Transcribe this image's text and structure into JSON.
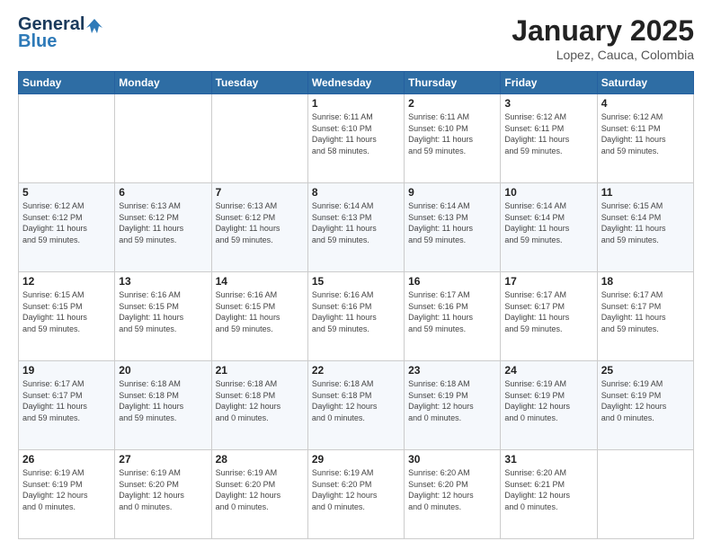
{
  "header": {
    "logo_general": "General",
    "logo_blue": "Blue",
    "title": "January 2025",
    "subtitle": "Lopez, Cauca, Colombia"
  },
  "weekdays": [
    "Sunday",
    "Monday",
    "Tuesday",
    "Wednesday",
    "Thursday",
    "Friday",
    "Saturday"
  ],
  "weeks": [
    [
      {
        "day": "",
        "info": ""
      },
      {
        "day": "",
        "info": ""
      },
      {
        "day": "",
        "info": ""
      },
      {
        "day": "1",
        "info": "Sunrise: 6:11 AM\nSunset: 6:10 PM\nDaylight: 11 hours\nand 58 minutes."
      },
      {
        "day": "2",
        "info": "Sunrise: 6:11 AM\nSunset: 6:10 PM\nDaylight: 11 hours\nand 59 minutes."
      },
      {
        "day": "3",
        "info": "Sunrise: 6:12 AM\nSunset: 6:11 PM\nDaylight: 11 hours\nand 59 minutes."
      },
      {
        "day": "4",
        "info": "Sunrise: 6:12 AM\nSunset: 6:11 PM\nDaylight: 11 hours\nand 59 minutes."
      }
    ],
    [
      {
        "day": "5",
        "info": "Sunrise: 6:12 AM\nSunset: 6:12 PM\nDaylight: 11 hours\nand 59 minutes."
      },
      {
        "day": "6",
        "info": "Sunrise: 6:13 AM\nSunset: 6:12 PM\nDaylight: 11 hours\nand 59 minutes."
      },
      {
        "day": "7",
        "info": "Sunrise: 6:13 AM\nSunset: 6:12 PM\nDaylight: 11 hours\nand 59 minutes."
      },
      {
        "day": "8",
        "info": "Sunrise: 6:14 AM\nSunset: 6:13 PM\nDaylight: 11 hours\nand 59 minutes."
      },
      {
        "day": "9",
        "info": "Sunrise: 6:14 AM\nSunset: 6:13 PM\nDaylight: 11 hours\nand 59 minutes."
      },
      {
        "day": "10",
        "info": "Sunrise: 6:14 AM\nSunset: 6:14 PM\nDaylight: 11 hours\nand 59 minutes."
      },
      {
        "day": "11",
        "info": "Sunrise: 6:15 AM\nSunset: 6:14 PM\nDaylight: 11 hours\nand 59 minutes."
      }
    ],
    [
      {
        "day": "12",
        "info": "Sunrise: 6:15 AM\nSunset: 6:15 PM\nDaylight: 11 hours\nand 59 minutes."
      },
      {
        "day": "13",
        "info": "Sunrise: 6:16 AM\nSunset: 6:15 PM\nDaylight: 11 hours\nand 59 minutes."
      },
      {
        "day": "14",
        "info": "Sunrise: 6:16 AM\nSunset: 6:15 PM\nDaylight: 11 hours\nand 59 minutes."
      },
      {
        "day": "15",
        "info": "Sunrise: 6:16 AM\nSunset: 6:16 PM\nDaylight: 11 hours\nand 59 minutes."
      },
      {
        "day": "16",
        "info": "Sunrise: 6:17 AM\nSunset: 6:16 PM\nDaylight: 11 hours\nand 59 minutes."
      },
      {
        "day": "17",
        "info": "Sunrise: 6:17 AM\nSunset: 6:17 PM\nDaylight: 11 hours\nand 59 minutes."
      },
      {
        "day": "18",
        "info": "Sunrise: 6:17 AM\nSunset: 6:17 PM\nDaylight: 11 hours\nand 59 minutes."
      }
    ],
    [
      {
        "day": "19",
        "info": "Sunrise: 6:17 AM\nSunset: 6:17 PM\nDaylight: 11 hours\nand 59 minutes."
      },
      {
        "day": "20",
        "info": "Sunrise: 6:18 AM\nSunset: 6:18 PM\nDaylight: 11 hours\nand 59 minutes."
      },
      {
        "day": "21",
        "info": "Sunrise: 6:18 AM\nSunset: 6:18 PM\nDaylight: 12 hours\nand 0 minutes."
      },
      {
        "day": "22",
        "info": "Sunrise: 6:18 AM\nSunset: 6:18 PM\nDaylight: 12 hours\nand 0 minutes."
      },
      {
        "day": "23",
        "info": "Sunrise: 6:18 AM\nSunset: 6:19 PM\nDaylight: 12 hours\nand 0 minutes."
      },
      {
        "day": "24",
        "info": "Sunrise: 6:19 AM\nSunset: 6:19 PM\nDaylight: 12 hours\nand 0 minutes."
      },
      {
        "day": "25",
        "info": "Sunrise: 6:19 AM\nSunset: 6:19 PM\nDaylight: 12 hours\nand 0 minutes."
      }
    ],
    [
      {
        "day": "26",
        "info": "Sunrise: 6:19 AM\nSunset: 6:19 PM\nDaylight: 12 hours\nand 0 minutes."
      },
      {
        "day": "27",
        "info": "Sunrise: 6:19 AM\nSunset: 6:20 PM\nDaylight: 12 hours\nand 0 minutes."
      },
      {
        "day": "28",
        "info": "Sunrise: 6:19 AM\nSunset: 6:20 PM\nDaylight: 12 hours\nand 0 minutes."
      },
      {
        "day": "29",
        "info": "Sunrise: 6:19 AM\nSunset: 6:20 PM\nDaylight: 12 hours\nand 0 minutes."
      },
      {
        "day": "30",
        "info": "Sunrise: 6:20 AM\nSunset: 6:20 PM\nDaylight: 12 hours\nand 0 minutes."
      },
      {
        "day": "31",
        "info": "Sunrise: 6:20 AM\nSunset: 6:21 PM\nDaylight: 12 hours\nand 0 minutes."
      },
      {
        "day": "",
        "info": ""
      }
    ]
  ]
}
